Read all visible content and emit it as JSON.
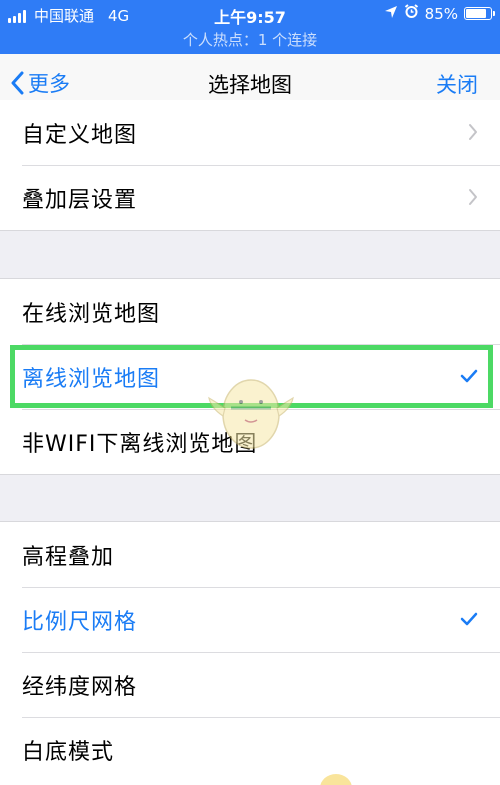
{
  "status_bar": {
    "carrier": "中国联通",
    "network": "4G",
    "time": "上午9:57",
    "battery_percent": "85%",
    "battery_level": 0.85,
    "hotspot_text": "个人热点：1 个连接",
    "icons": [
      "signal-icon",
      "location-icon",
      "alarm-icon",
      "battery-icon"
    ],
    "background_color": "#2f7cf6"
  },
  "nav": {
    "back_label": "更多",
    "title": "选择地图",
    "close_label": "关闭",
    "accent_color": "#1a7cf5"
  },
  "group1": [
    {
      "label": "自定义地图",
      "accessory": "chevron"
    },
    {
      "label": "叠加层设置",
      "accessory": "chevron"
    }
  ],
  "group2": [
    {
      "label": "在线浏览地图",
      "accessory": "none",
      "selected": false
    },
    {
      "label": "离线浏览地图",
      "accessory": "checkmark",
      "selected": true
    },
    {
      "label": "非WIFI下离线浏览地图",
      "accessory": "none",
      "selected": false
    }
  ],
  "group3": [
    {
      "label": "高程叠加",
      "accessory": "none",
      "selected": false
    },
    {
      "label": "比例尺网格",
      "accessory": "checkmark",
      "selected": true
    },
    {
      "label": "经纬度网格",
      "accessory": "none",
      "selected": false
    },
    {
      "label": "白底模式",
      "accessory": "none",
      "selected": false
    }
  ],
  "highlight_color": "#4cd964"
}
